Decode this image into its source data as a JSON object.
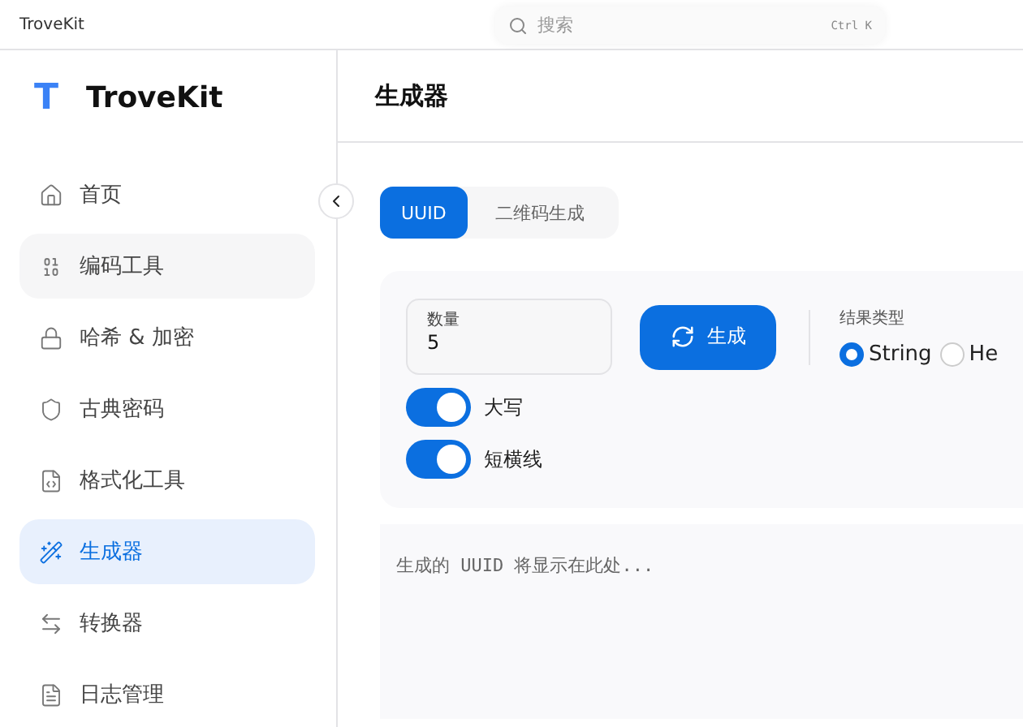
{
  "window": {
    "title": "TroveKit"
  },
  "search": {
    "placeholder": "搜索",
    "shortcut": "Ctrl K"
  },
  "sidebar": {
    "brand": "TroveKit",
    "logo": "T",
    "items": [
      {
        "label": "首页",
        "selected": false
      },
      {
        "label": "编码工具",
        "selected": false
      },
      {
        "label": "哈希 & 加密",
        "selected": false
      },
      {
        "label": "古典密码",
        "selected": false
      },
      {
        "label": "格式化工具",
        "selected": false
      },
      {
        "label": "生成器",
        "selected": true
      },
      {
        "label": "转换器",
        "selected": false
      },
      {
        "label": "日志管理",
        "selected": false
      }
    ]
  },
  "page": {
    "title": "生成器"
  },
  "tabs": [
    {
      "label": "UUID",
      "selected": true
    },
    {
      "label": "二维码生成",
      "selected": false
    }
  ],
  "count_field": {
    "label": "数量",
    "value": "5"
  },
  "generate_button": "生成",
  "result_type": {
    "label": "结果类型",
    "options": [
      {
        "label": "String",
        "selected": true
      },
      {
        "label": "He",
        "selected": false
      }
    ]
  },
  "toggles": [
    {
      "label": "大写",
      "on": true
    },
    {
      "label": "短横线",
      "on": true
    }
  ],
  "output": {
    "placeholder": "生成的 UUID 将显示在此处..."
  }
}
